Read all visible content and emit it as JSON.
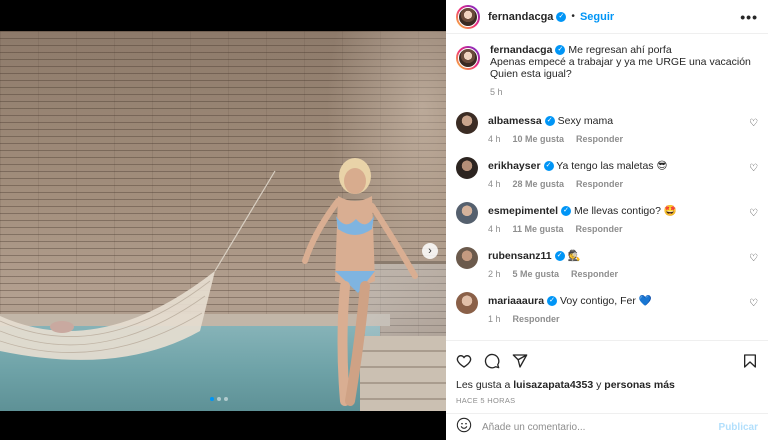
{
  "post": {
    "username": "fernandacga",
    "follow_label": "Seguir",
    "separator": "•",
    "more_label": "•••",
    "caption_line1": "Me regresan ahí porfa",
    "caption_line2": "Apenas empecé a trabajar y ya me URGE una vacación",
    "caption_line3": "Quien esta igual?",
    "caption_time": "5 h"
  },
  "comments": [
    {
      "user": "albamessa",
      "text": "Sexy mama",
      "time": "4 h",
      "likes": "10 Me gusta",
      "reply": "Responder",
      "verified": true
    },
    {
      "user": "erikhayser",
      "text": "Ya tengo las maletas 😎",
      "time": "4 h",
      "likes": "28 Me gusta",
      "reply": "Responder",
      "verified": true
    },
    {
      "user": "esmepimentel",
      "text": "Me llevas contigo? 🤩",
      "time": "4 h",
      "likes": "11 Me gusta",
      "reply": "Responder",
      "verified": true
    },
    {
      "user": "rubensanz11",
      "text": "🕵",
      "time": "2 h",
      "likes": "5 Me gusta",
      "reply": "Responder",
      "verified": true
    },
    {
      "user": "mariaaaura",
      "text": "Voy contigo, Fer 💙",
      "time": "1 h",
      "likes": "",
      "reply": "Responder",
      "verified": true
    }
  ],
  "likes_line": {
    "prefix": "Les gusta a ",
    "user": "luisazapata4353",
    "suffix": " y ",
    "others": "personas más"
  },
  "time_ago": "Hace 5 horas",
  "add_comment": {
    "placeholder": "Añade un comentario...",
    "publish_label": "Publicar"
  },
  "carousel": {
    "next_label": "›",
    "current_slide": 1,
    "total_slides": 3
  },
  "colors": {
    "accent": "#0095f6",
    "publish_disabled": "#b2dffc",
    "text": "#262626",
    "muted": "#8e8e8e"
  },
  "icons": [
    "heart-icon",
    "comment-icon",
    "share-icon",
    "bookmark-icon",
    "emoji-icon",
    "more-icon",
    "verified-icon",
    "chevron-right-icon"
  ]
}
